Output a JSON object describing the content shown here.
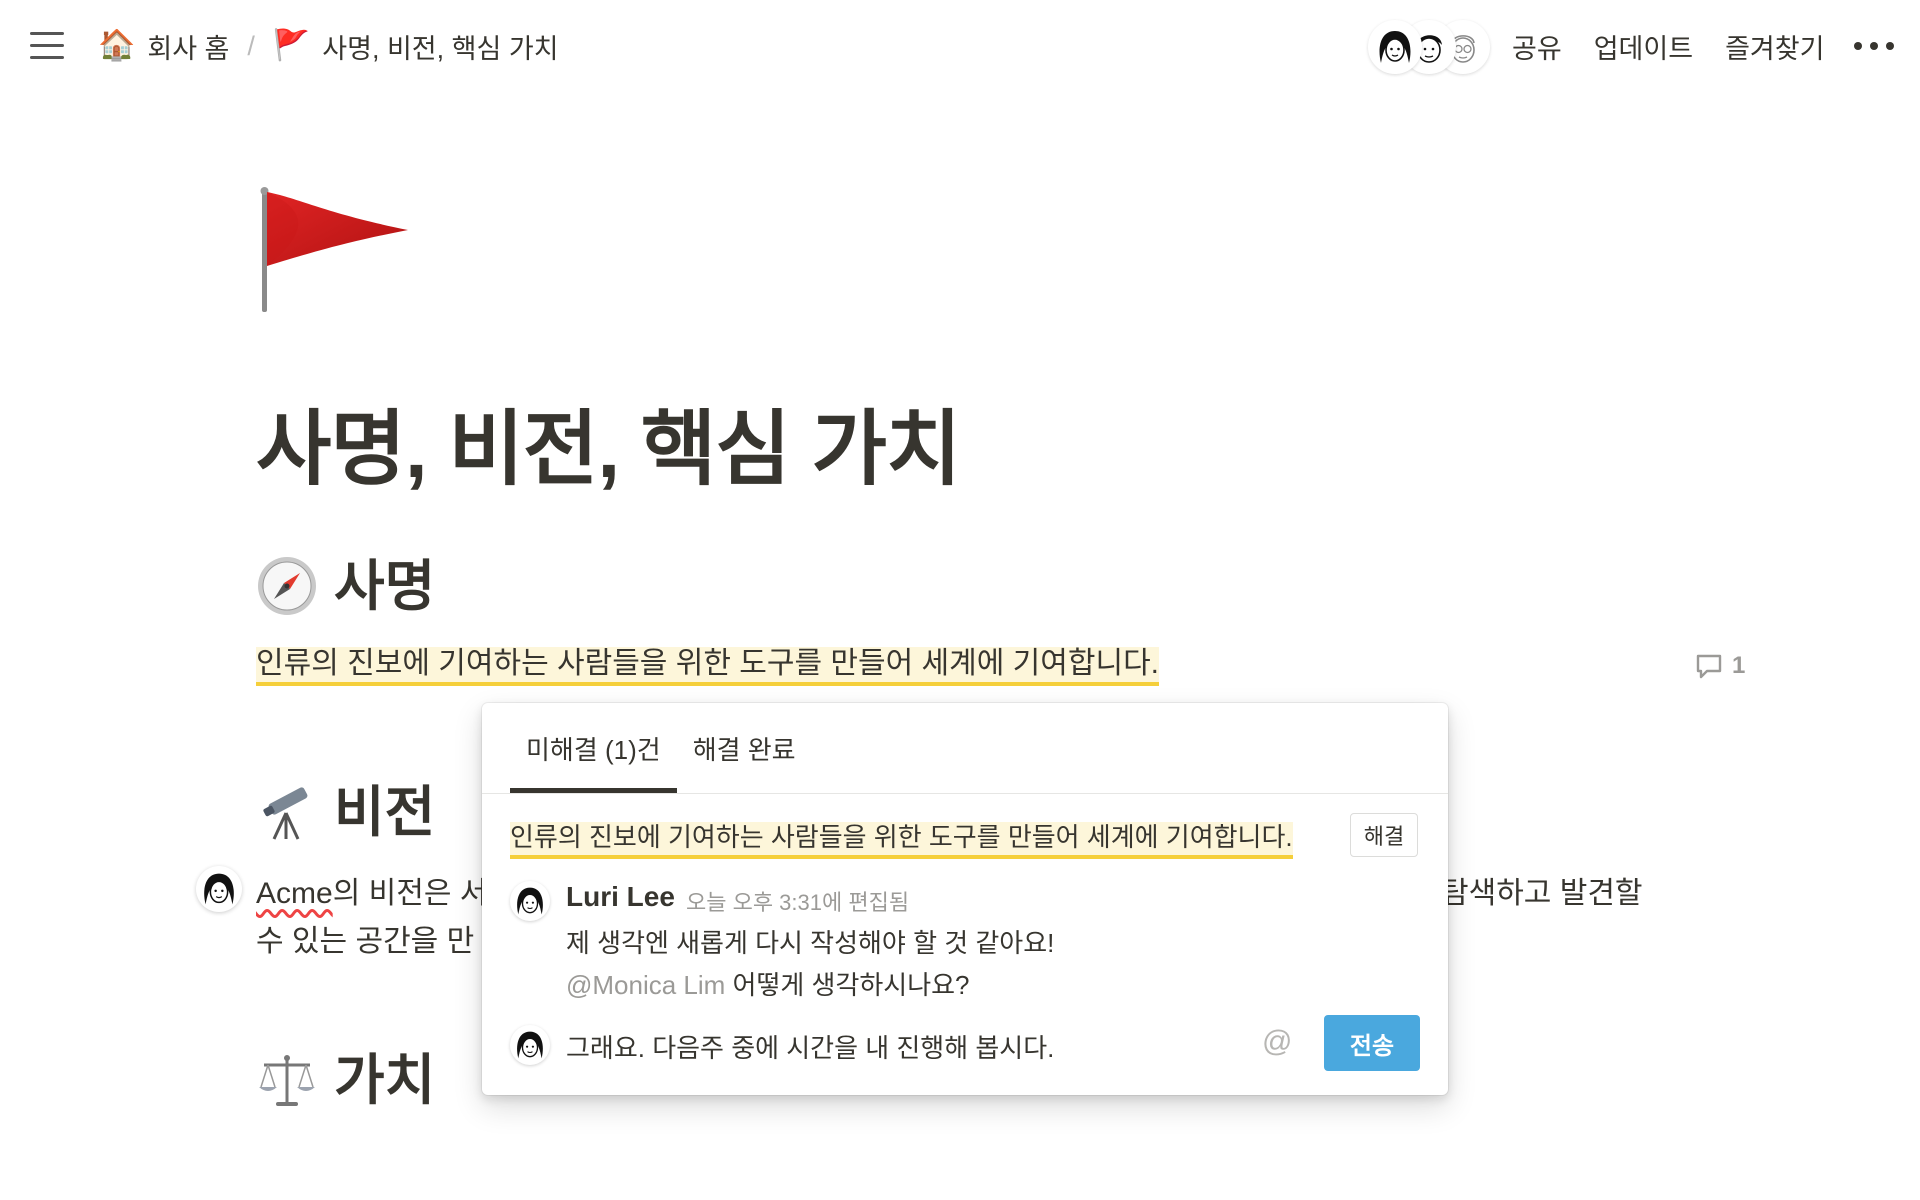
{
  "topbar": {
    "breadcrumb": [
      {
        "icon": "house-emoji",
        "emoji": "🏠",
        "label": "회사 홈"
      },
      {
        "icon": "red-flag-emoji",
        "emoji": "🚩",
        "label": "사명, 비전, 핵심 가치"
      }
    ],
    "separator": "/",
    "actions": {
      "share": "공유",
      "updates": "업데이트",
      "favorite": "즐겨찾기"
    }
  },
  "page": {
    "icon": "red-flag-icon",
    "title": "사명, 비전, 핵심 가치",
    "sections": {
      "mission": {
        "icon": "compass-icon",
        "heading": "사명",
        "text": "인류의 진보에 기여하는 사람들을 위한 도구를 만들어 세계에 기여합니다.",
        "comment_count": "1"
      },
      "vision": {
        "icon": "telescope-icon",
        "heading": "비전",
        "line1_start": "의 비전은 ",
        "acme": "Acme",
        "line1_visible_start": "서",
        "line1_tail": "탐색하고 발견할",
        "line2": "수 있는 공간을 만"
      },
      "values": {
        "icon": "scales-icon",
        "heading": "가치"
      }
    }
  },
  "comments": {
    "tabs": {
      "open": "미해결 (1)건",
      "resolved": "해결 완료"
    },
    "quote": "인류의 진보에 기여하는 사람들을 위한 도구를 만들어 세계에 기여합니다.",
    "resolve_label": "해결",
    "thread": {
      "author": "Luri Lee",
      "meta": "오늘 오후 3:31에 편집됨",
      "body_line1": "제 생각엔 새롭게 다시 작성해야 할 것 같아요!",
      "mention": "@Monica Lim",
      "body_line2": " 어떻게 생각하시나요?"
    },
    "reply_value": "그래요. 다음주 중에 시간을 내 진행해 봅시다.",
    "at_symbol": "@",
    "send_label": "전송"
  },
  "colors": {
    "highlight_bg": "#fdf6da",
    "highlight_underline": "#f5cf3a",
    "send_button": "#4aa8de",
    "text": "#37352f",
    "muted": "#9b9a97"
  }
}
